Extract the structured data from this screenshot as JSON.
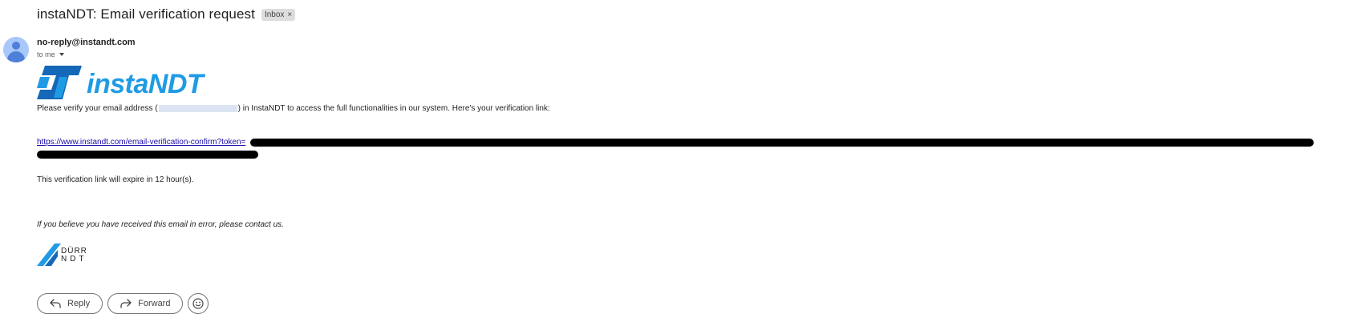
{
  "email": {
    "subject": "instaNDT: Email verification request",
    "label": "Inbox",
    "label_remove": "×",
    "sender": "no-reply@instandt.com",
    "recipient": "to me"
  },
  "body": {
    "logo_text": "instaNDT",
    "verify_prefix": "Please verify your email address (",
    "verify_suffix": ") in InstaNDT to access the full functionalities in our system. Here's your verification link:",
    "link_text": "https://www.instandt.com/email-verification-confirm?token=",
    "expiry_text": "This verification link will expire in 12 hour(s).",
    "error_text": "If you believe you have received this email in error, please contact us.",
    "footer_logo": {
      "line1": "DÜRR",
      "line2": "NDT"
    }
  },
  "actions": {
    "reply_label": "Reply",
    "forward_label": "Forward"
  },
  "colors": {
    "logo_blue": "#1f9be5",
    "logo_dark_blue": "#1568b8",
    "link": "#1a0dab"
  },
  "icons": [
    "avatar-icon",
    "chevron-down-icon",
    "instandt-logo-icon",
    "durr-logo-icon",
    "reply-icon",
    "forward-icon",
    "emoji-icon"
  ]
}
